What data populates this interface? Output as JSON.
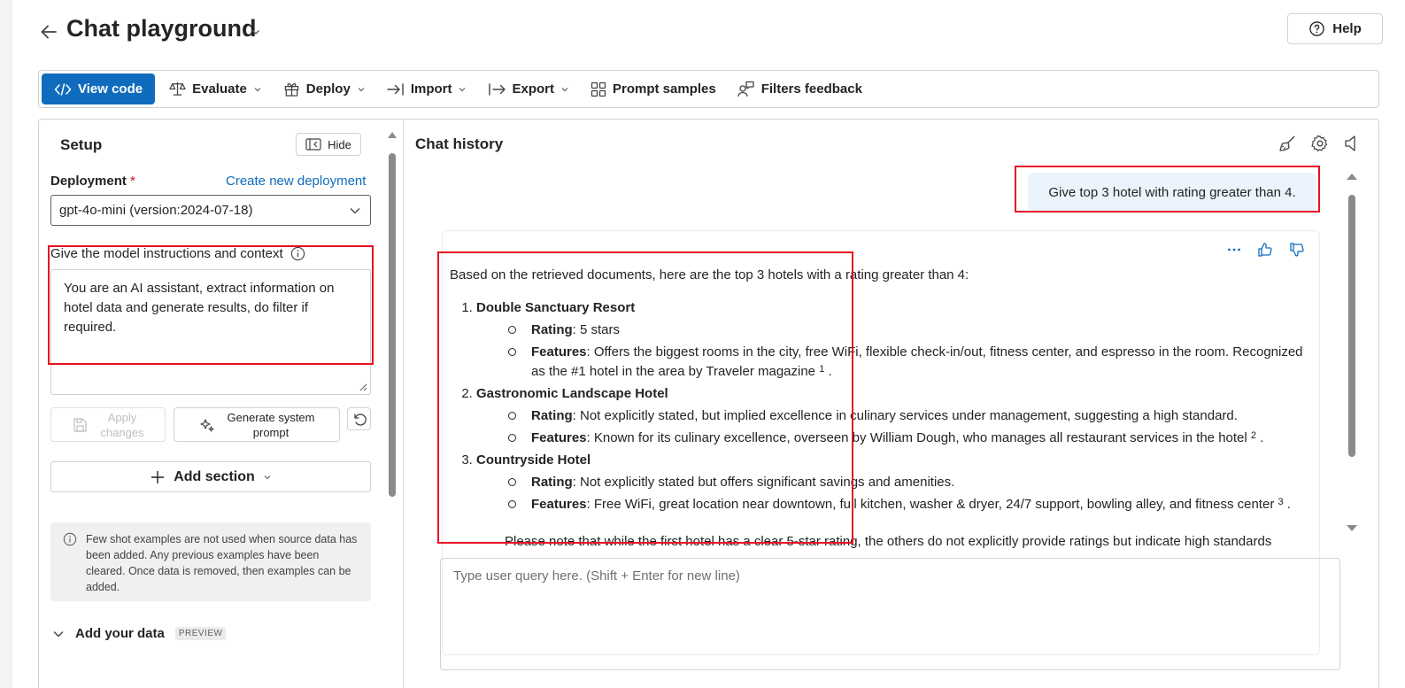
{
  "header": {
    "title": "Chat playground",
    "help_label": "Help"
  },
  "toolbar": {
    "view_code": "View code",
    "evaluate": "Evaluate",
    "deploy": "Deploy",
    "import": "Import",
    "export": "Export",
    "prompt_samples": "Prompt samples",
    "filters_feedback": "Filters feedback"
  },
  "setup": {
    "title": "Setup",
    "hide_label": "Hide",
    "deployment_label": "Deployment",
    "required_mark": "*",
    "create_link": "Create new deployment",
    "deployment_value": "gpt-4o-mini (version:2024-07-18)",
    "instructions_label": "Give the model instructions and context",
    "instructions_text": "You are an AI assistant, extract information on hotel data and generate results, do filter if required.",
    "apply_label_1": "Apply",
    "apply_label_2": "changes",
    "generate_label_1": "Generate system",
    "generate_label_2": "prompt",
    "add_section_label": "Add section",
    "info_text": "Few shot examples are not used when source data has been added. Any previous examples have been cleared. Once data is removed, then examples can be added.",
    "add_data_label": "Add your data",
    "preview_tag": "PREVIEW"
  },
  "chat": {
    "title": "Chat history",
    "user_message": "Give top 3 hotel with rating greater than 4.",
    "answer": {
      "intro": "Based on the retrieved documents, here are the top 3 hotels with a rating greater than 4:",
      "hotels": [
        {
          "name": "Double Sanctuary Resort",
          "rating_key": "Rating",
          "rating": ": 5 stars",
          "features_key": "Features",
          "features": ": Offers the biggest rooms in the city, free WiFi, flexible check-in/out, fitness center, and espresso in the room. Recognized as the #1 hotel in the area by Traveler magazine",
          "ref": "1"
        },
        {
          "name": "Gastronomic Landscape Hotel",
          "rating_key": "Rating",
          "rating": ": Not explicitly stated, but implied excellence in culinary services under management, suggesting a high standard.",
          "features_key": "Features",
          "features": ": Known for its culinary excellence, overseen by William Dough, who manages all restaurant services in the hotel",
          "ref": "2"
        },
        {
          "name": "Countryside Hotel",
          "rating_key": "Rating",
          "rating": ": Not explicitly stated but offers significant savings and amenities.",
          "features_key": "Features",
          "features": ": Free WiFi, great location near downtown, full kitchen, washer & dryer, 24/7 support, bowling alley, and fitness center",
          "ref": "3"
        }
      ],
      "note": "Please note that while the first hotel has a clear 5-star rating, the others do not explicitly provide ratings but indicate high standards"
    },
    "input_placeholder": "Type user query here. (Shift + Enter for new line)"
  },
  "colors": {
    "accent": "#0f6cbd",
    "highlight_box": "#e81123",
    "user_bubble": "#ebf3fc"
  }
}
